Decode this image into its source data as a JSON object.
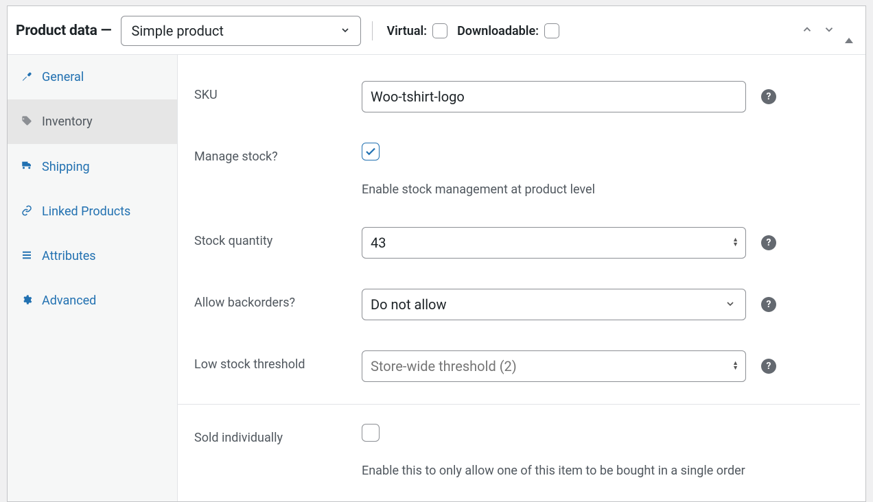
{
  "header": {
    "title": "Product data —",
    "product_type": "Simple product",
    "virtual_label": "Virtual:",
    "virtual_checked": false,
    "downloadable_label": "Downloadable:",
    "downloadable_checked": false
  },
  "sidebar": {
    "items": [
      {
        "label": "General"
      },
      {
        "label": "Inventory"
      },
      {
        "label": "Shipping"
      },
      {
        "label": "Linked Products"
      },
      {
        "label": "Attributes"
      },
      {
        "label": "Advanced"
      }
    ],
    "active_index": 1
  },
  "form": {
    "sku": {
      "label": "SKU",
      "value": "Woo-tshirt-logo"
    },
    "manage_stock": {
      "label": "Manage stock?",
      "checked": true,
      "description": "Enable stock management at product level"
    },
    "stock_qty": {
      "label": "Stock quantity",
      "value": "43"
    },
    "backorders": {
      "label": "Allow backorders?",
      "value": "Do not allow"
    },
    "low_stock": {
      "label": "Low stock threshold",
      "placeholder": "Store-wide threshold (2)",
      "value": ""
    },
    "sold_individually": {
      "label": "Sold individually",
      "checked": false,
      "description": "Enable this to only allow one of this item to be bought in a single order"
    }
  }
}
